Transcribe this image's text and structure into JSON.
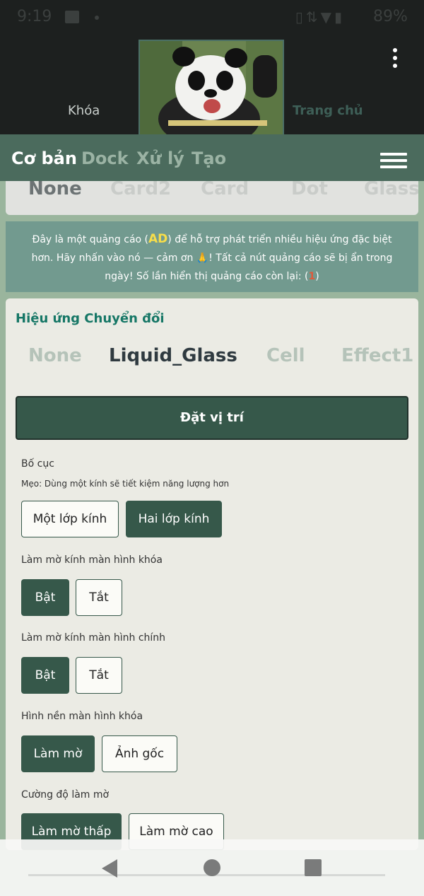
{
  "status_bar": {
    "time": "9:19",
    "battery": "89%",
    "icons": [
      "image-icon",
      "dot-icon",
      "vibrate-icon",
      "data-icon",
      "wifi-icon",
      "battery-icon"
    ]
  },
  "header": {
    "lock_label": "Khóa",
    "home_label": "Trang chủ"
  },
  "tabs": [
    {
      "label": "Cơ bản",
      "active": true
    },
    {
      "label": "Dock",
      "active": false
    },
    {
      "label": "Xử lý",
      "active": false
    },
    {
      "label": "Tạo",
      "active": false
    }
  ],
  "peek_row": [
    "None",
    "Card2",
    "Card",
    "Dot",
    "Glass"
  ],
  "ad": {
    "part1": "Đây là một quảng cáo (",
    "ad_tag": "AD",
    "part2": ") để hỗ trợ phát triển nhiều hiệu ứng đặc biệt hơn. Hãy nhấn vào nó — cảm ơn ",
    "emoji": "🙏",
    "part3": "! Tất cả nút quảng cáo sẽ bị ẩn trong ngày! Số lần hiển thị quảng cáo còn lại: (",
    "count": "1",
    "part4": ")"
  },
  "transition": {
    "title": "Hiệu ứng Chuyển đổi",
    "effects": [
      "None",
      "Liquid_Glass",
      "Cell",
      "Effect1"
    ],
    "selected": "Liquid_Glass",
    "place_button": "Đặt vị trí"
  },
  "layout": {
    "label": "Bố cục",
    "tip": "Mẹo: Dùng một kính sẽ tiết kiệm năng lượng hơn",
    "options": [
      "Một lớp kính",
      "Hai lớp kính"
    ],
    "selected": "Hai lớp kính"
  },
  "blur_lock": {
    "label": "Làm mờ kính màn hình khóa",
    "options": [
      "Bật",
      "Tắt"
    ],
    "selected": "Bật"
  },
  "blur_home": {
    "label": "Làm mờ kính màn hình chính",
    "options": [
      "Bật",
      "Tắt"
    ],
    "selected": "Bật"
  },
  "lock_wallpaper": {
    "label": "Hình nền màn hình khóa",
    "options": [
      "Làm mờ",
      "Ảnh gốc"
    ],
    "selected": "Làm mờ"
  },
  "blur_strength": {
    "label": "Cường độ làm mờ",
    "options": [
      "Làm mờ thấp",
      "Làm mờ cao"
    ],
    "selected": "Làm mờ thấp"
  },
  "colors": {
    "accent": "#36584a",
    "tabbar": "#4b6b5d",
    "title_teal": "#167766",
    "ad_bg": "#729a8f",
    "ad_highlight": "#f7dd4a"
  }
}
